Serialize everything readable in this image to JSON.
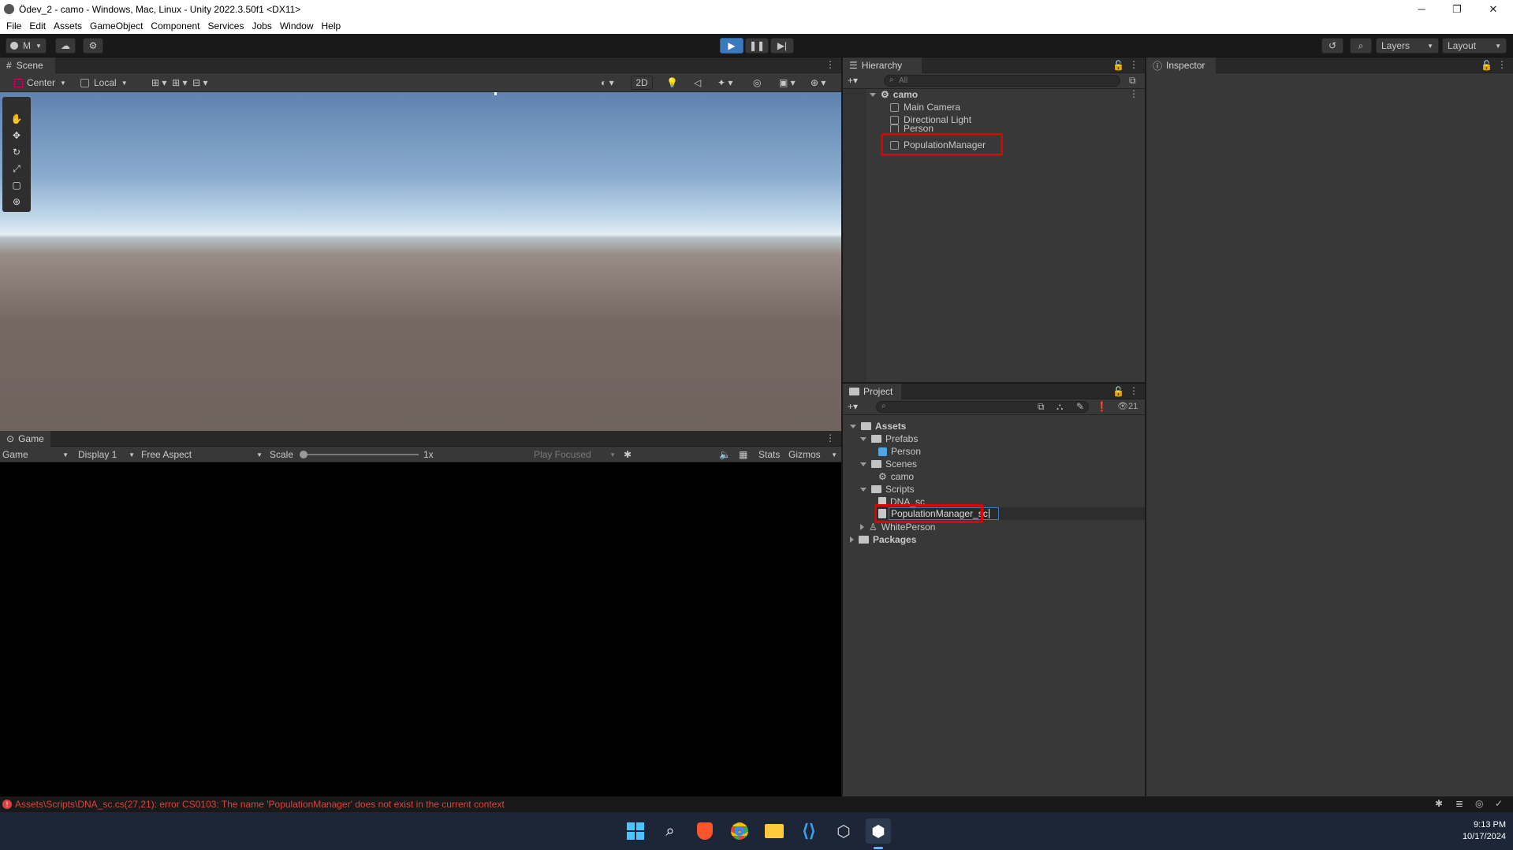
{
  "window": {
    "title": "Ödev_2 - camo - Windows, Mac, Linux - Unity 2022.3.50f1 <DX11>",
    "minimize": "─",
    "restore": "❐",
    "close": "✕"
  },
  "menu": [
    "File",
    "Edit",
    "Assets",
    "GameObject",
    "Component",
    "Services",
    "Jobs",
    "Window",
    "Help"
  ],
  "toolbar": {
    "account": "M",
    "layers": "Layers",
    "layout": "Layout"
  },
  "scene": {
    "tab": "Scene",
    "pivot": "Center",
    "space": "Local",
    "mode2d": "2D"
  },
  "game": {
    "tab": "Game",
    "view": "Game",
    "display": "Display 1",
    "aspect": "Free Aspect",
    "scale_label": "Scale",
    "scale_value": "1x",
    "scale_level": 0.0,
    "play_focused": "Play Focused",
    "stats": "Stats",
    "gizmos": "Gizmos"
  },
  "hierarchy": {
    "tab": "Hierarchy",
    "search_placeholder": "All",
    "scene_name": "camo",
    "items": [
      "Main Camera",
      "Directional Light",
      "Person",
      "PopulationManager"
    ]
  },
  "inspector": {
    "tab": "Inspector"
  },
  "project": {
    "tab": "Project",
    "count": "21",
    "assets": "Assets",
    "prefabs": "Prefabs",
    "prefab_person": "Person",
    "scenes": "Scenes",
    "scene_camo": "camo",
    "scripts": "Scripts",
    "dna": "DNA_sc",
    "rename_value": "PopulationManager_sc",
    "white_person": "WhitePerson",
    "packages": "Packages"
  },
  "status": {
    "error": "Assets\\Scripts\\DNA_sc.cs(27,21): error CS0103: The name 'PopulationManager' does not exist in the current context"
  },
  "clock": {
    "time": "9:13 PM",
    "date": "10/17/2024"
  },
  "colors": {
    "accent": "#3a79bb",
    "error": "#d64541",
    "highlight": "#e00000"
  }
}
